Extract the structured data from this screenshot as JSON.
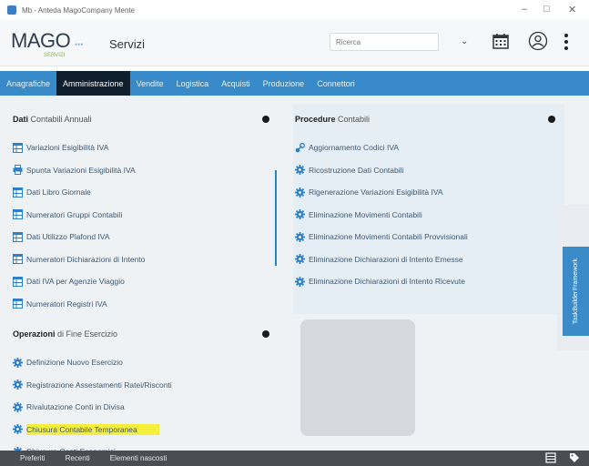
{
  "window": {
    "title": "Mb - Anteda MagoCompany Mente",
    "controls": [
      "–",
      "□",
      "✕"
    ]
  },
  "header": {
    "logo_prefix": "MAGO",
    "logo_dots": "•••",
    "logo_sub": "SERVIZI",
    "section": "Servizi",
    "search_placeholder": "Ricerca",
    "dropdown_arrow": "⌄"
  },
  "tabs": [
    {
      "label": "Anagrafiche",
      "active": false
    },
    {
      "label": "Amministrazione",
      "active": true
    },
    {
      "label": "Vendite",
      "active": false
    },
    {
      "label": "Logistica",
      "active": false
    },
    {
      "label": "Acquisti",
      "active": false
    },
    {
      "label": "Produzione",
      "active": false
    },
    {
      "label": "Connettori",
      "active": false
    }
  ],
  "left_groups": [
    {
      "title_bold": "Dati",
      "title_rest": " Contabili Annuali",
      "items": [
        {
          "label": "Variazioni Esigibilità IVA",
          "icon": "table-icon"
        },
        {
          "label": "Spunta Variazioni Esigibilità IVA",
          "icon": "print-icon"
        },
        {
          "label": "Dati Libro Giornale",
          "icon": "table-icon"
        },
        {
          "label": "Numeratori Gruppi Contabili",
          "icon": "table-icon"
        },
        {
          "label": "Dati Utilizzo Plafond IVA",
          "icon": "table-icon"
        },
        {
          "label": "Numeratori Dichiarazioni di Intento",
          "icon": "table-icon"
        },
        {
          "label": "Dati IVA per Agenzie Viaggio",
          "icon": "table-icon"
        },
        {
          "label": "Numeratori Registri IVA",
          "icon": "table-icon"
        }
      ]
    },
    {
      "title_bold": "Operazioni",
      "title_rest": " di Fine Esercizio",
      "items": [
        {
          "label": "Definizione Nuovo Esercizio",
          "icon": "gear-icon"
        },
        {
          "label": "Registrazione Assestamenti Ratei/Risconti",
          "icon": "gear-icon"
        },
        {
          "label": "Rivalutazione Conti in Divisa",
          "icon": "gear-icon"
        },
        {
          "label": "Chiusura Contabile Temporanea",
          "icon": "gear-icon",
          "highlighted": true
        },
        {
          "label": "Chiusura Conti Economici",
          "icon": "gear-icon"
        }
      ]
    }
  ],
  "right_group": {
    "title_bold": "Procedure",
    "title_rest": " Contabili",
    "items": [
      {
        "label": "Aggiornamento Codici IVA",
        "icon": "link-icon"
      },
      {
        "label": "Ricostruzione Dati Contabili",
        "icon": "gear-icon"
      },
      {
        "label": "Rigenerazione Variazioni Esigibilità IVA",
        "icon": "gear-icon"
      },
      {
        "label": "Eliminazione Movimenti Contabili",
        "icon": "gear-icon"
      },
      {
        "label": "Eliminazione Movimenti Contabili Provvisionali",
        "icon": "gear-icon"
      },
      {
        "label": "Eliminazione Dichiarazioni di Intento Emesse",
        "icon": "gear-icon"
      },
      {
        "label": "Eliminazione Dichiarazioni di Intento Ricevute",
        "icon": "gear-icon"
      }
    ]
  },
  "side_tab": {
    "line1": "TaskBuilder",
    "line2": "Framework"
  },
  "footer": {
    "items": [
      "Preferiti",
      "Recenti",
      "Elementi nascosti"
    ]
  },
  "colors": {
    "tabbar": "#3889c7",
    "tab_active": "#0f1f2e",
    "link": "#3d5a75",
    "icon_blue": "#2e7fc5",
    "highlight": "#f5ee3a",
    "footer": "#4a4d52"
  }
}
